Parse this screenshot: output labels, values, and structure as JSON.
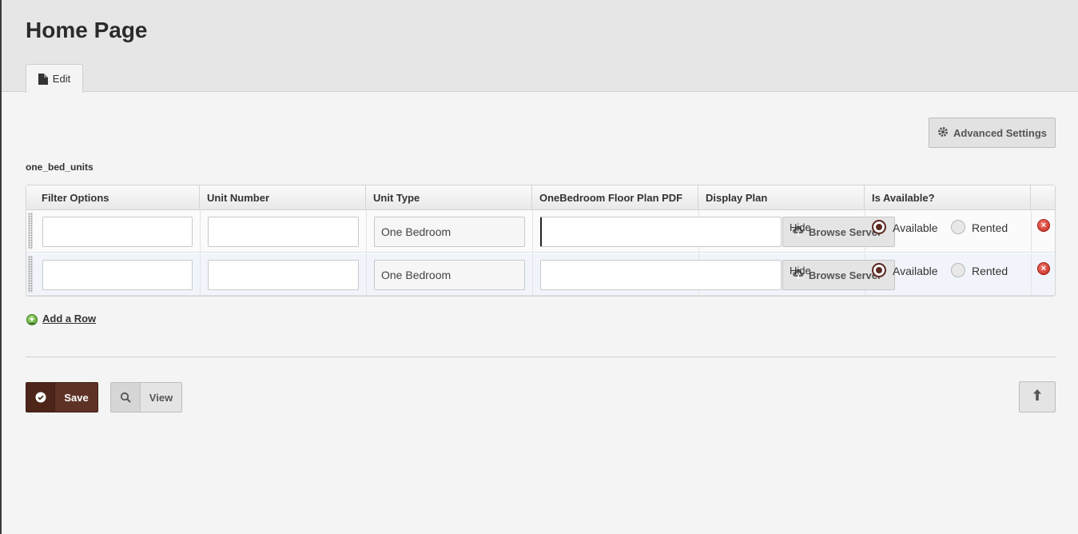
{
  "header": {
    "title": "Home Page",
    "tab_edit_label": "Edit"
  },
  "advanced_settings_label": "Advanced Settings",
  "field_label": "one_bed_units",
  "table": {
    "columns": [
      "Filter Options",
      "Unit Number",
      "Unit Type",
      "OneBedroom Floor Plan PDF",
      "Display Plan",
      "Is Available?"
    ],
    "rows": [
      {
        "filter_options": "",
        "unit_number": "",
        "unit_type": "One Bedroom",
        "floor_plan_pdf": "",
        "display_plan_hide": "Hide",
        "browse_label": "Browse Server",
        "available_label": "Available",
        "rented_label": "Rented",
        "selected": "Available"
      },
      {
        "filter_options": "",
        "unit_number": "",
        "unit_type": "One Bedroom",
        "floor_plan_pdf": "",
        "display_plan_hide": "Hide",
        "browse_label": "Browse Server",
        "available_label": "Available",
        "rented_label": "Rented",
        "selected": "Available"
      }
    ]
  },
  "add_row_label": "Add a Row",
  "footer": {
    "save_label": "Save",
    "view_label": "View"
  },
  "colors": {
    "accent": "#5e3326",
    "delete": "#c2261b",
    "add": "#4e9a2a"
  }
}
